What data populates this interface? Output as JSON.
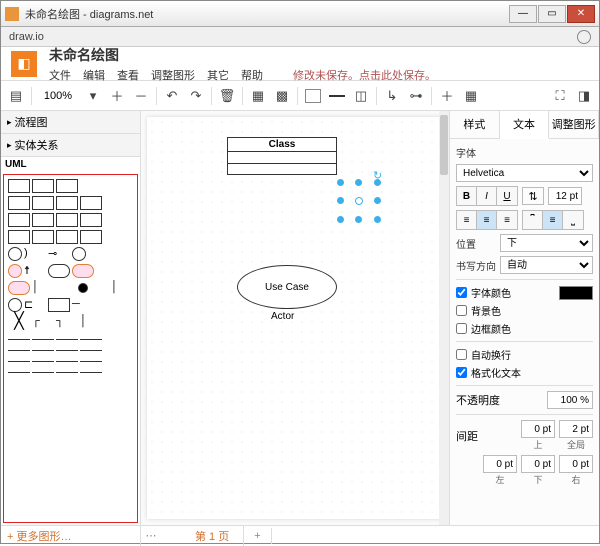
{
  "window": {
    "title": "未命名绘图 - diagrams.net"
  },
  "addrbar": {
    "text": "draw.io"
  },
  "header": {
    "doc_title": "未命名绘图",
    "menu": [
      "文件",
      "编辑",
      "查看",
      "调整图形",
      "其它",
      "帮助"
    ],
    "warn": "修改未保存。点击此处保存。"
  },
  "toolbar": {
    "zoom": "100%"
  },
  "sidebar": {
    "sections": [
      "流程图",
      "实体关系",
      "UML"
    ],
    "more": "+ 更多图形…"
  },
  "canvas": {
    "class_label": "Class",
    "usecase_label": "Use Case",
    "actor_label": "Actor"
  },
  "pages": {
    "tab1": "第 1 页",
    "add": "+"
  },
  "panel": {
    "tabs": [
      "样式",
      "文本",
      "调整图形"
    ],
    "font_label": "字体",
    "font_family": "Helvetica",
    "font_size": "12 pt",
    "pos_label": "位置",
    "pos_value": "下",
    "dir_label": "书写方向",
    "dir_value": "自动",
    "font_color": "字体颜色",
    "bg_color": "背景色",
    "border_color": "边框颜色",
    "wrap": "自动换行",
    "formatted": "格式化文本",
    "opacity_label": "不透明度",
    "opacity_value": "100 %",
    "spacing_label": "间距",
    "sp_val0": "0 pt",
    "sp_val2": "2 pt",
    "sp_top": "上",
    "sp_global": "全局",
    "sp_left": "左",
    "sp_bottom": "下",
    "sp_right": "右"
  }
}
